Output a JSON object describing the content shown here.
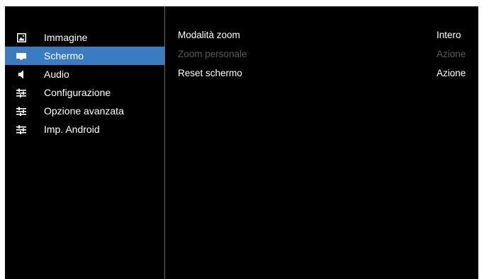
{
  "sidebar": {
    "items": [
      {
        "label": "Immagine",
        "icon": "picture-icon"
      },
      {
        "label": "Schermo",
        "icon": "screen-icon"
      },
      {
        "label": "Audio",
        "icon": "speaker-icon"
      },
      {
        "label": "Configurazione",
        "icon": "sliders-icon"
      },
      {
        "label": "Opzione avanzata",
        "icon": "sliders-icon"
      },
      {
        "label": "Imp. Android",
        "icon": "sliders-icon"
      }
    ],
    "selected_index": 1,
    "selected_color": "#3a7bc1"
  },
  "settings": {
    "rows": [
      {
        "label": "Modalità zoom",
        "value": "Intero",
        "enabled": true
      },
      {
        "label": "Zoom personale",
        "value": "Azione",
        "enabled": false
      },
      {
        "label": "Reset schermo",
        "value": "Azione",
        "enabled": true
      }
    ]
  }
}
